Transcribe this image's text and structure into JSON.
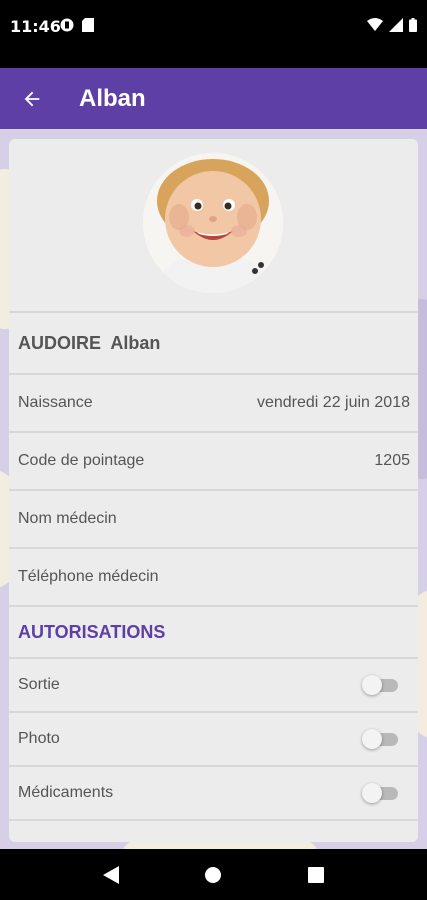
{
  "status_bar": {
    "time": "11:46",
    "left_icons": [
      "app-notification-icon",
      "sd-card-icon"
    ],
    "right_icons": [
      "wifi-icon",
      "signal-icon",
      "battery-icon"
    ]
  },
  "app_bar": {
    "title": "Alban",
    "back_icon": "arrow-left-icon",
    "color": "#5e3fa5"
  },
  "profile": {
    "avatar": "child-photo-avatar",
    "full_name": "AUDOIRE  Alban",
    "fields": [
      {
        "label": "Naissance",
        "value": "vendredi 22 juin 2018"
      },
      {
        "label": "Code de pointage",
        "value": "1205"
      },
      {
        "label": "Nom médecin",
        "value": ""
      },
      {
        "label": "Téléphone médecin",
        "value": ""
      }
    ]
  },
  "authorizations": {
    "title": "AUTORISATIONS",
    "items": [
      {
        "label": "Sortie",
        "enabled": false
      },
      {
        "label": "Photo",
        "enabled": false
      },
      {
        "label": "Médicaments",
        "enabled": false
      }
    ]
  },
  "nav_bar": {
    "buttons": [
      "back-triangle-icon",
      "home-circle-icon",
      "recents-square-icon"
    ]
  }
}
